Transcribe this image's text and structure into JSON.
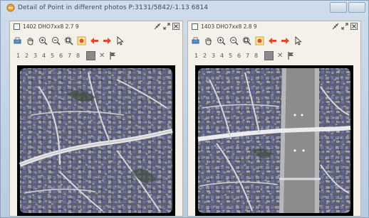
{
  "window": {
    "title": "Detail of Point in different photos  P:3131/5842/-1.13 6814"
  },
  "panels": [
    {
      "title": "1402  DHO7xx8 2.7 9",
      "numbers": [
        "1",
        "2",
        "3",
        "4",
        "5",
        "6",
        "7",
        "8"
      ]
    },
    {
      "title": "1403  DHO7xx8 2.8 9",
      "numbers": [
        "1",
        "2",
        "3",
        "4",
        "5",
        "6",
        "7",
        "8"
      ]
    }
  ],
  "colors": {
    "window_bg": "#c9d6e6",
    "panel_bg": "#f3f1ea",
    "accent": "#2f63b8",
    "river": "#8c8c8c",
    "road": "#f0f0f0"
  },
  "icons": {
    "toolbar": [
      "print-icon",
      "pan-hand-icon",
      "zoom-in-icon",
      "zoom-out-icon",
      "zoom-extent-icon",
      "point-icon",
      "arrow-left-icon",
      "arrow-right-icon",
      "pointer-icon"
    ]
  }
}
